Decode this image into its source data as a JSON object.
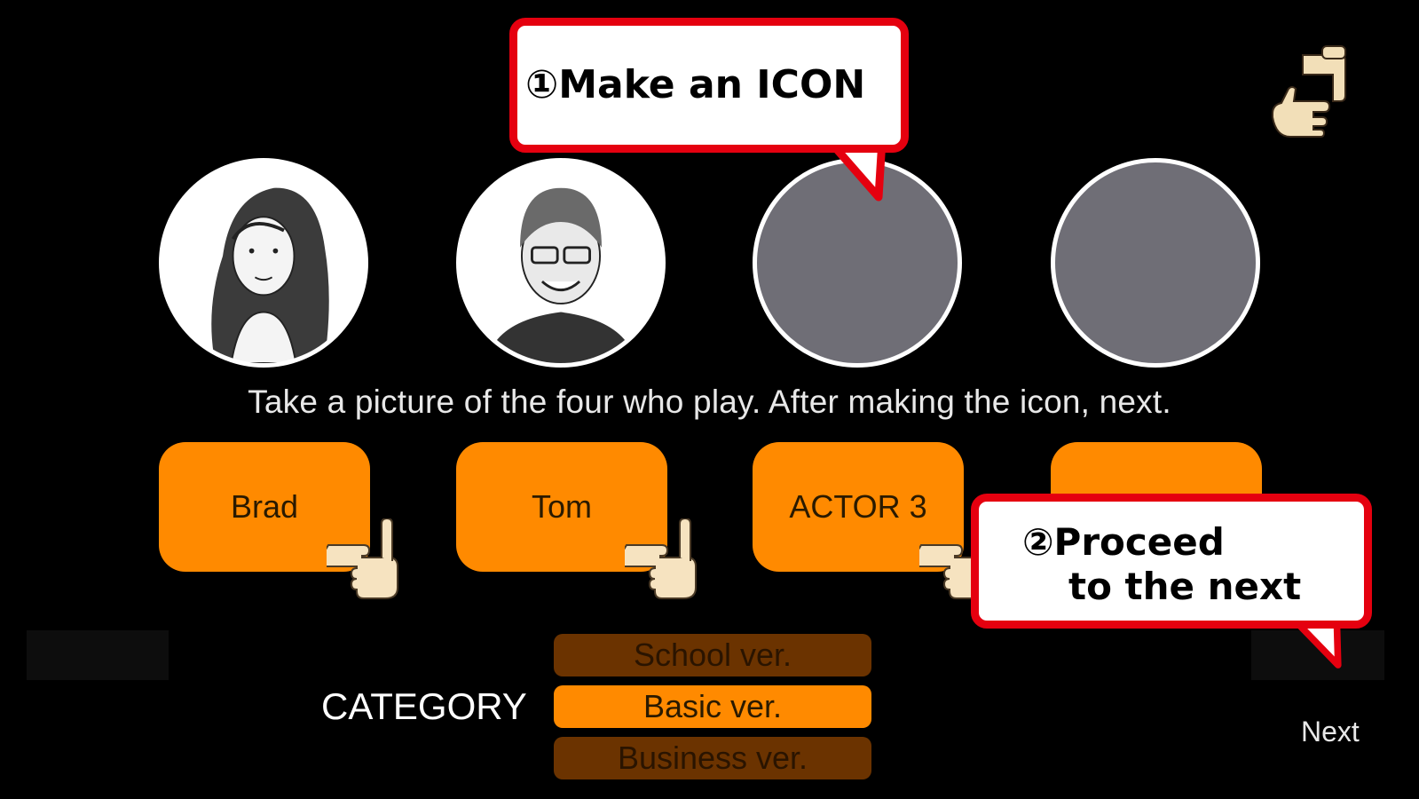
{
  "instruction": "Take a picture of the four who play. After making the icon, next.",
  "actors": [
    {
      "label": "Brad"
    },
    {
      "label": "Tom"
    },
    {
      "label": "ACTOR 3"
    },
    {
      "label": ""
    }
  ],
  "callouts": {
    "make_icon": "①Make an ICON",
    "proceed_line1": "②Proceed",
    "proceed_line2": "to the next"
  },
  "category": {
    "label": "CATEGORY",
    "options": [
      "School ver.",
      "Basic ver.",
      "Business ver."
    ],
    "selected": "Basic ver."
  },
  "next_label": "Next",
  "icons": {
    "rotate": "rotate-screen-icon",
    "hand": "pointing-hand-icon"
  },
  "colors": {
    "accent": "#ff8a00",
    "callout_border": "#e5000f",
    "empty_avatar": "#6f6e76"
  }
}
